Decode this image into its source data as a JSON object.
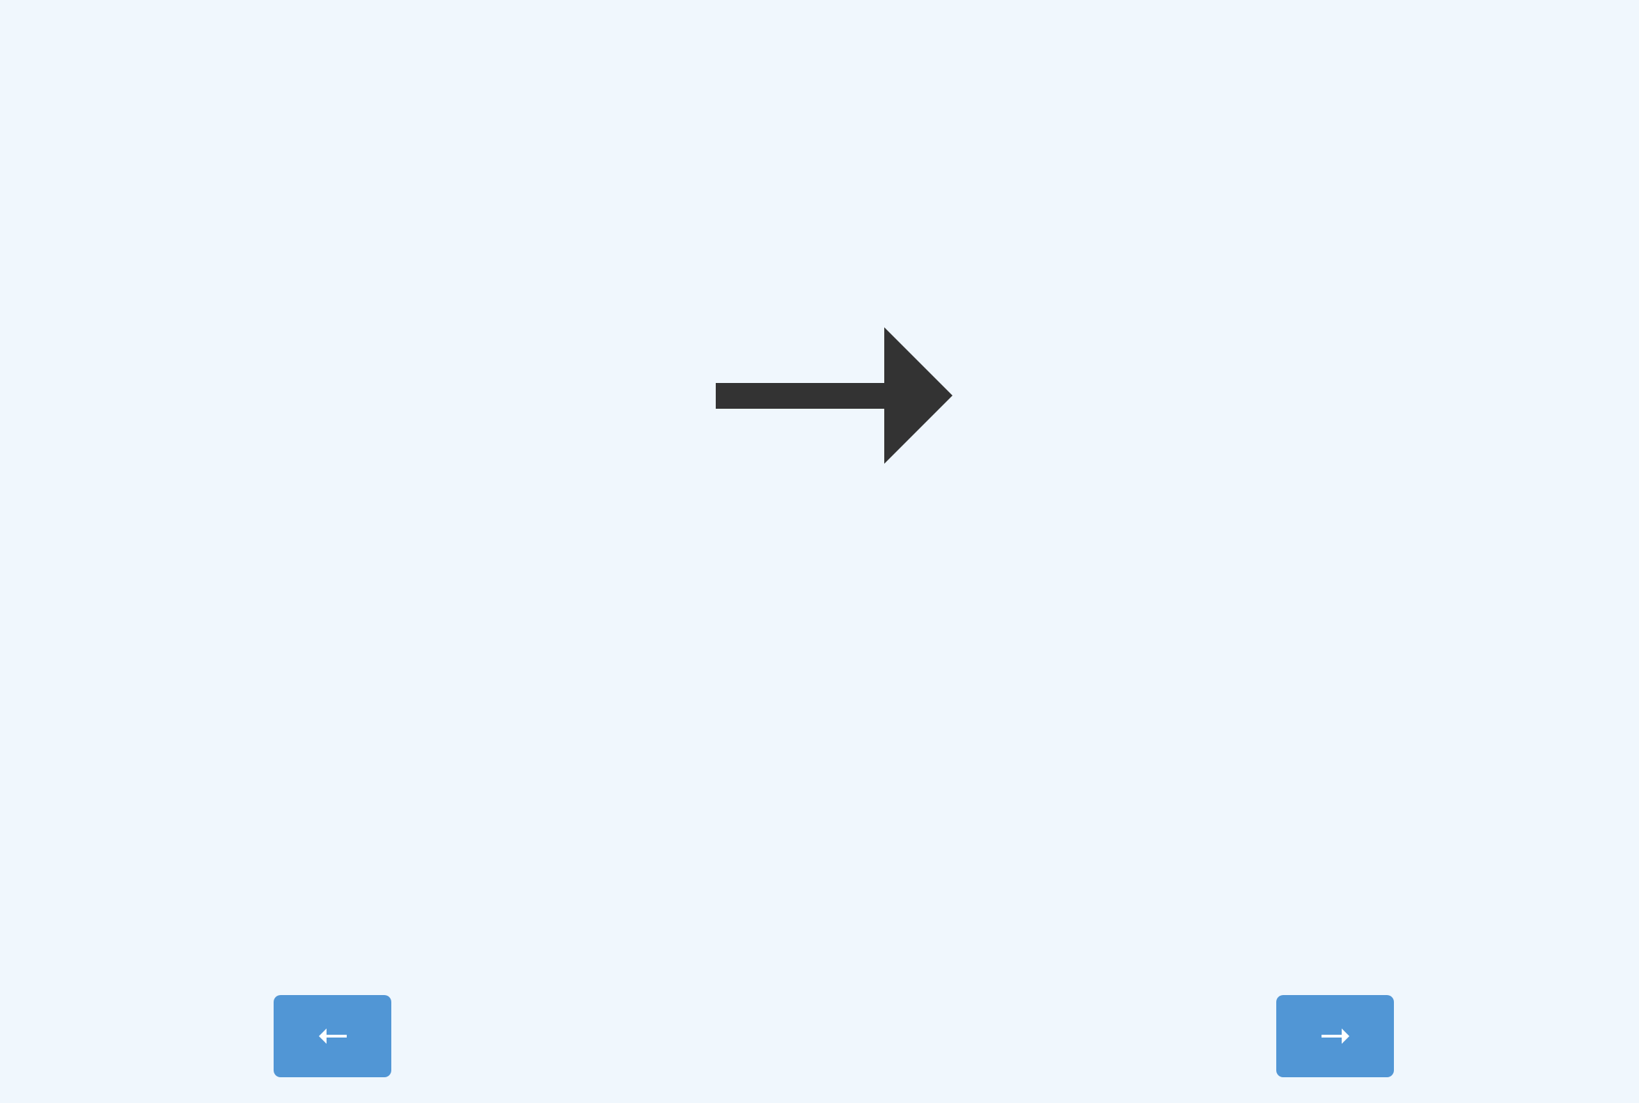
{
  "colors": {
    "background": "#f0f7fd",
    "arrow": "#333333",
    "button": "#5196d5",
    "button_icon": "#ffffff"
  },
  "main_arrow": {
    "icon": "right-arrow-icon",
    "direction": "right"
  },
  "buttons": {
    "previous": {
      "icon": "left-arrow-icon",
      "direction": "left"
    },
    "next": {
      "icon": "right-arrow-icon",
      "direction": "right"
    }
  }
}
